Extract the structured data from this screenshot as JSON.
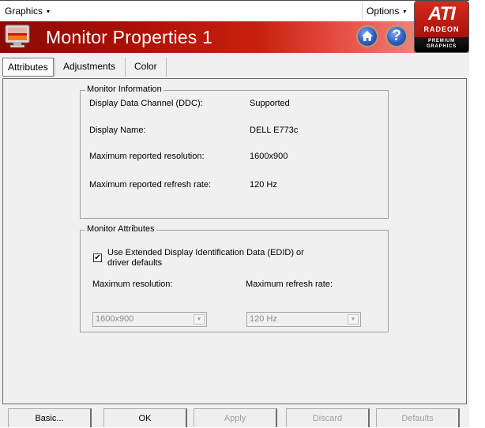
{
  "menubar": {
    "graphics_label": "Graphics",
    "options_label": "Options",
    "dropdown_glyph": "▾"
  },
  "banner": {
    "title": "Monitor Properties 1",
    "home_icon": "home-icon",
    "help_icon": "help-icon",
    "help_glyph": "?",
    "logo": {
      "brand": "ATI",
      "line1": "RADEON",
      "line2": "PREMIUM",
      "line3": "GRAPHICS"
    }
  },
  "tabs": [
    {
      "label": "Attributes",
      "active": true
    },
    {
      "label": "Adjustments",
      "active": false
    },
    {
      "label": "Color",
      "active": false
    }
  ],
  "monitor_information": {
    "title": "Monitor Information",
    "rows": [
      {
        "label": "Display Data Channel (DDC):",
        "value": "Supported"
      },
      {
        "label": "Display Name:",
        "value": "DELL E773c"
      },
      {
        "label": "Maximum reported resolution:",
        "value": "1600x900"
      },
      {
        "label": "Maximum reported refresh rate:",
        "value": "120 Hz"
      }
    ]
  },
  "monitor_attributes": {
    "title": "Monitor Attributes",
    "edid_checkbox": {
      "line1": "Use Extended Display Identification Data (EDID) or",
      "line2": "driver defaults",
      "checked": true,
      "check_glyph": "✔"
    },
    "max_resolution": {
      "label": "Maximum resolution:",
      "value": "1600x900",
      "enabled": false
    },
    "max_refresh": {
      "label": "Maximum refresh rate:",
      "value": "120 Hz",
      "enabled": false
    },
    "combo_arrow": "▼"
  },
  "buttons": {
    "basic": {
      "label": "Basic...",
      "enabled": true
    },
    "ok": {
      "label": "OK",
      "enabled": true
    },
    "apply": {
      "label": "Apply",
      "enabled": false
    },
    "discard": {
      "label": "Discard",
      "enabled": false
    },
    "defaults": {
      "label": "Defaults",
      "enabled": false
    }
  }
}
